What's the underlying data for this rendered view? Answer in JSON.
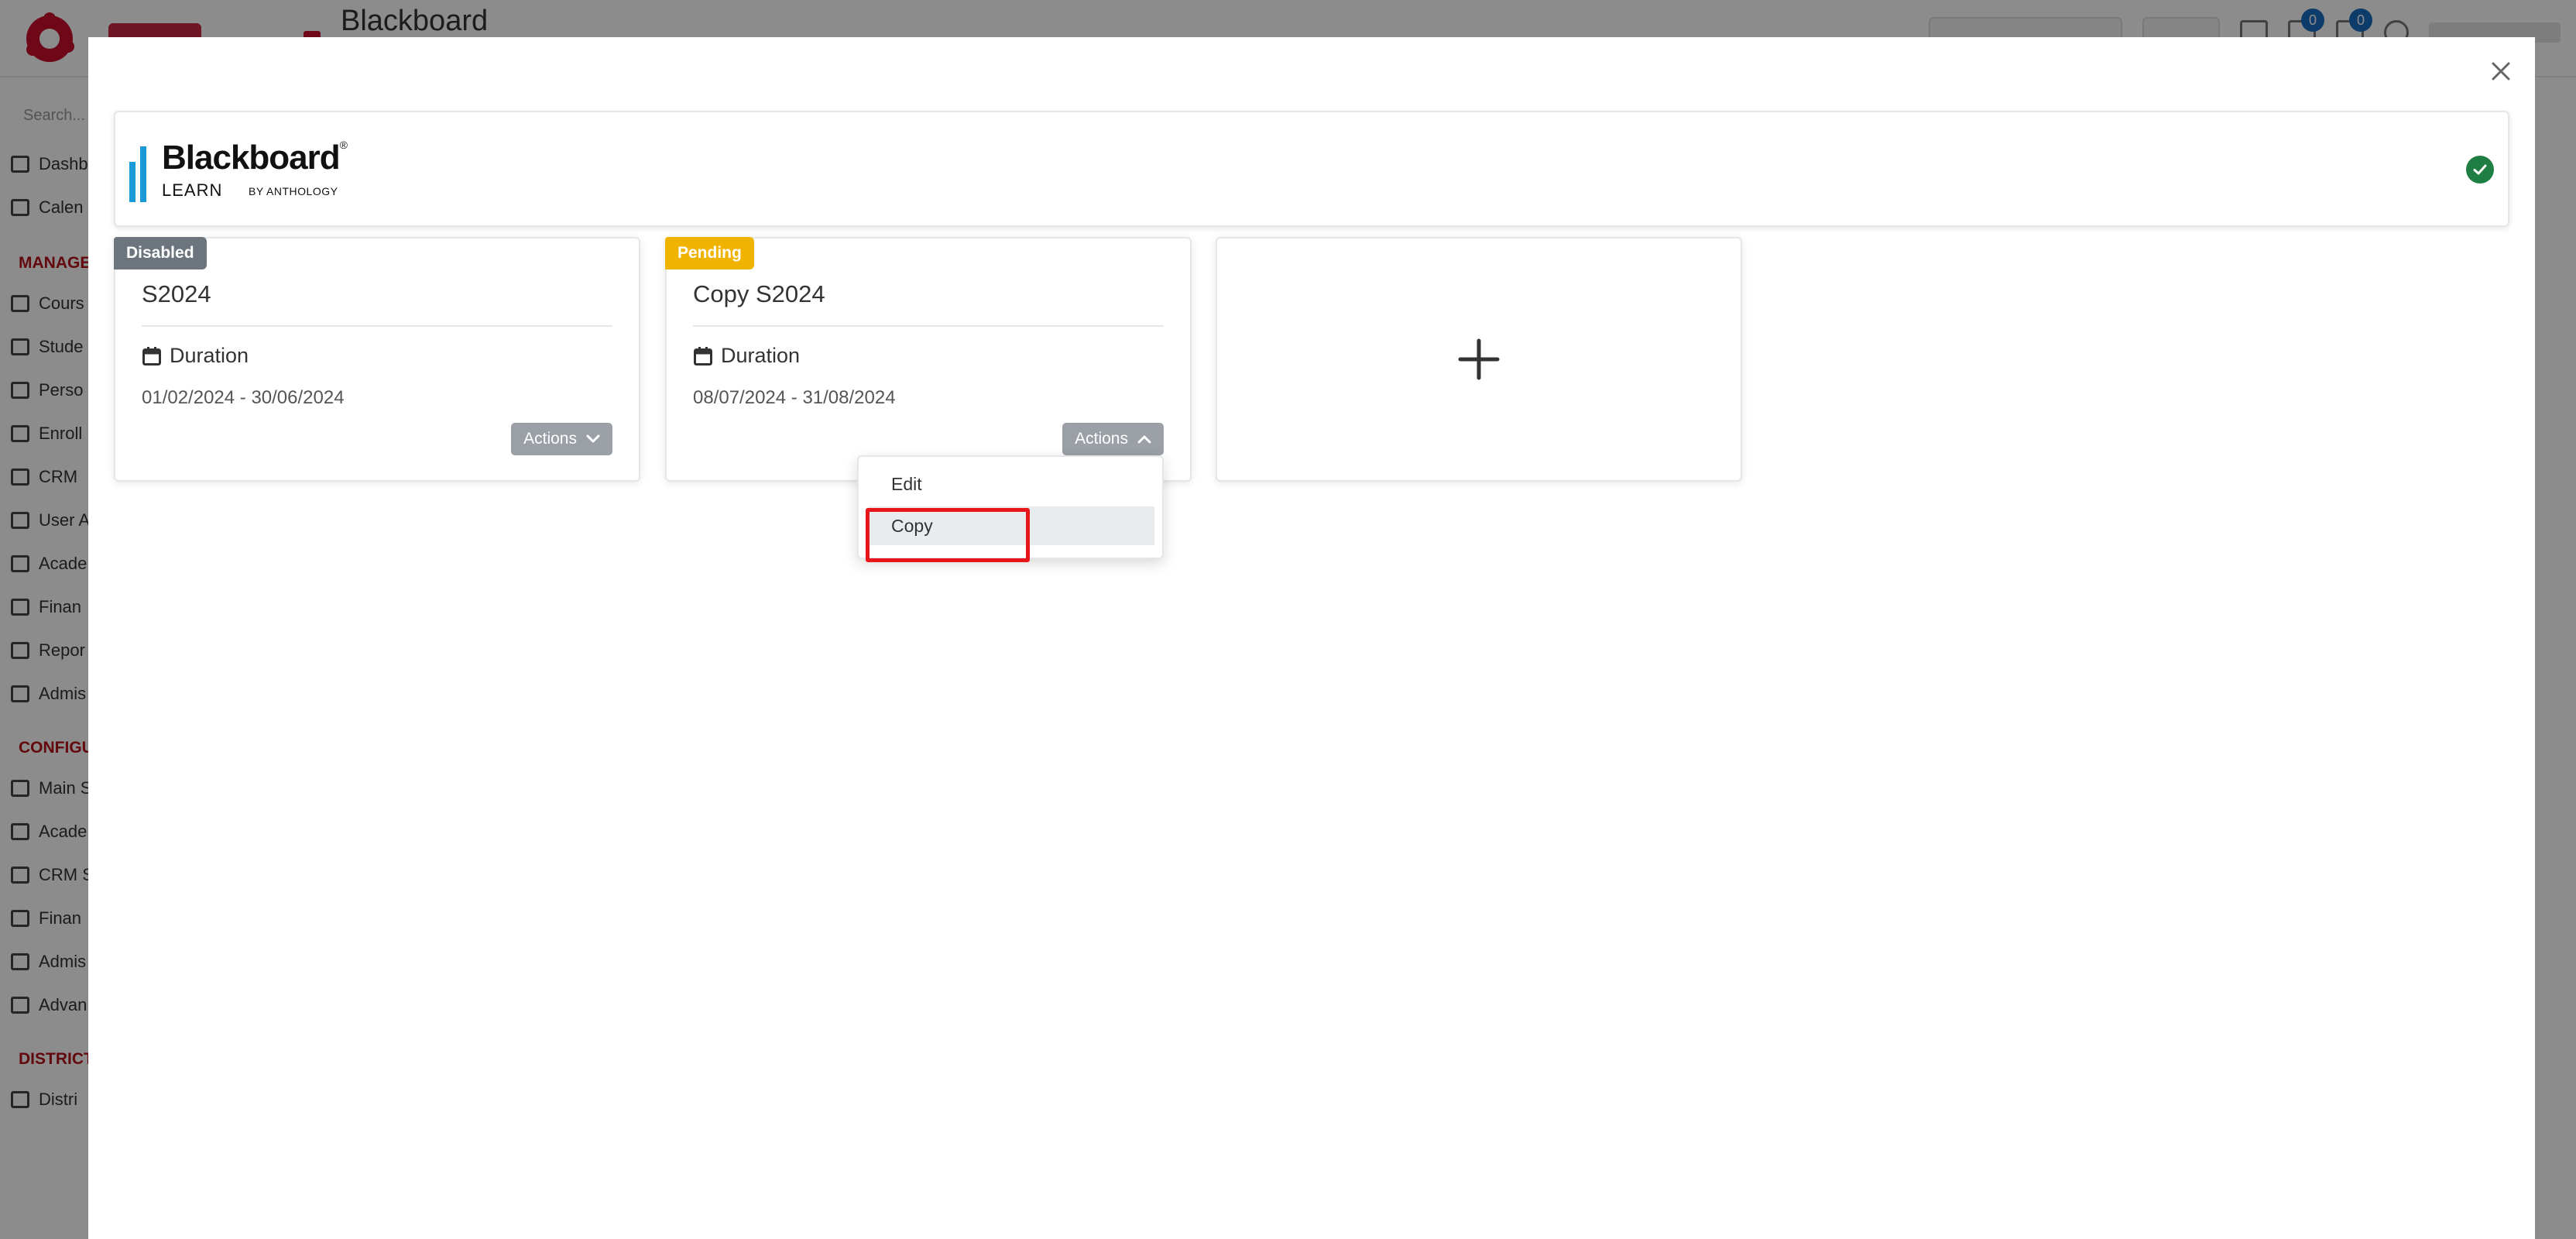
{
  "background_app": {
    "title": "Blackboard",
    "search_placeholder": "Search...",
    "badges": [
      "0",
      "0"
    ],
    "nav_items": [
      "Dashb",
      "Calen"
    ],
    "sections": [
      "MANAGE",
      "CONFIGU",
      "DISTRICT"
    ],
    "manage_items": [
      "Cours",
      "Stude",
      "Perso",
      "Enroll",
      "CRM",
      "User A",
      "Acade",
      "Finan",
      "Repor",
      "Admis"
    ],
    "config_items": [
      "Main S",
      "Acade",
      "CRM S",
      "Finan",
      "Admis",
      "Advan"
    ],
    "district_items": [
      "Distri"
    ]
  },
  "modal": {
    "close_symbol": "×",
    "lms": {
      "logo_word": "Blackboard",
      "logo_tm": "®",
      "logo_learn": "LEARN",
      "logo_by": "BY ANTHOLOGY",
      "status": "connected"
    },
    "terms": [
      {
        "badge": "Disabled",
        "name": "S2024",
        "duration_label": "Duration",
        "dates": "01/02/2024 - 30/06/2024",
        "actions_label": "Actions"
      },
      {
        "badge": "Pending",
        "name": "Copy S2024",
        "duration_label": "Duration",
        "dates": "08/07/2024 - 31/08/2024",
        "actions_label": "Actions"
      }
    ],
    "add_symbol": "+",
    "dropdown": {
      "edit_label": "Edit",
      "copy_label": "Copy"
    }
  },
  "colors": {
    "disabled_badge": "#6c757d",
    "pending_badge": "#f0b400",
    "status_ok": "#1e7e44",
    "highlight": "#e8151b",
    "brand_red": "#c8102e",
    "blackboard_blue": "#1a9bd7"
  }
}
